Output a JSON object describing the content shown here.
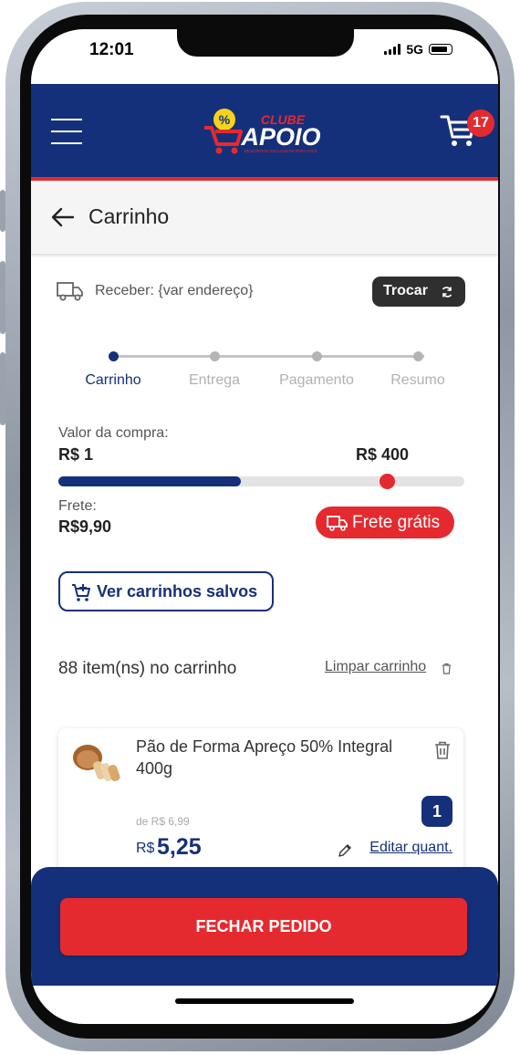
{
  "status_bar": {
    "time": "12:01",
    "network": "5G"
  },
  "header": {
    "logo_top": "CLUBE",
    "logo_main": "APOIO",
    "logo_tagline": "DESCONTOS EXCLUSIVOS PARA VOCÊ",
    "cart_count": "17"
  },
  "page": {
    "title": "Carrinho"
  },
  "delivery": {
    "label": "Receber: {var endereço}",
    "change_button": "Trocar"
  },
  "steps": [
    {
      "label": "Carrinho",
      "active": true
    },
    {
      "label": "Entrega",
      "active": false
    },
    {
      "label": "Pagamento",
      "active": false
    },
    {
      "label": "Resumo",
      "active": false
    }
  ],
  "purchase": {
    "label": "Valor da compra:",
    "min": "R$ 1",
    "max": "R$ 400",
    "progress_fraction": 0.45,
    "marker_fraction": 0.81
  },
  "shipping": {
    "label": "Frete:",
    "value": "R$9,90",
    "badge": "Frete grátis"
  },
  "saved_carts_button": "Ver carrinhos salvos",
  "cart_summary": {
    "count_text": "88 item(ns) no carrinho",
    "clear_link": "Limpar carrinho"
  },
  "product": {
    "name": "Pão de Forma Apreço 50% Integral 400g",
    "old_price": "de R$ 6,99",
    "currency": "R$",
    "price": "5,25",
    "quantity": "1",
    "edit_link": "Editar quant."
  },
  "checkout_button": "FECHAR PEDIDO",
  "colors": {
    "primary": "#15307a",
    "accent": "#e52a2f",
    "dark_button": "#2f2f2f"
  }
}
